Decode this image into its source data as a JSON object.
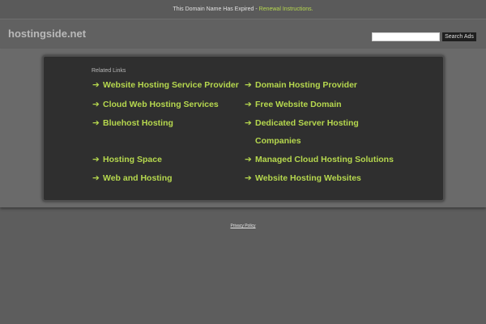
{
  "topbar": {
    "expired_text": "This Domain Name Has Expired - ",
    "renewal_link": "Renewal Instructions."
  },
  "header": {
    "logo": "hostingside.net",
    "search_button": "Search Ads",
    "search_value": ""
  },
  "related": {
    "title": "Related Links",
    "arrow": "➔",
    "left": [
      "Website Hosting Service Provider",
      "Cloud Web Hosting Services",
      "Bluehost Hosting",
      "Hosting Space",
      "Web and Hosting"
    ],
    "right": [
      "Domain Hosting Provider",
      "Free Website Domain",
      "Dedicated Server Hosting",
      "Companies",
      "Managed Cloud Hosting Solutions",
      "Website Hosting Websites"
    ]
  },
  "footer": {
    "privacy": "Privacy Policy"
  },
  "colors": {
    "background": "#5d5d5d",
    "panel": "#2f2f2f",
    "link": "#b6d84e"
  }
}
